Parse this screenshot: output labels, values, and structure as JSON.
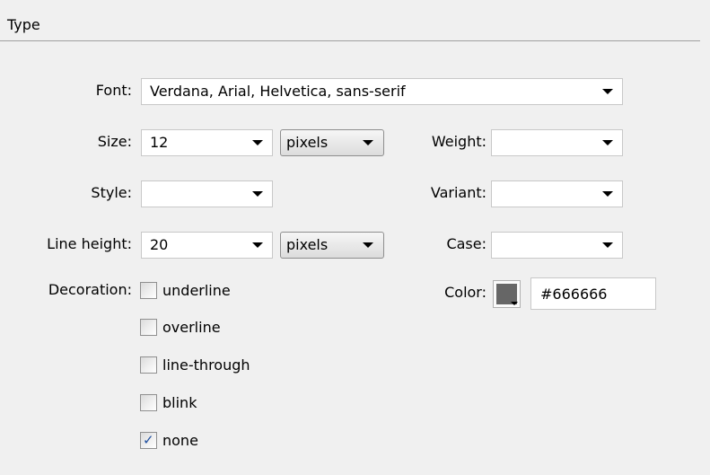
{
  "section": {
    "title": "Type"
  },
  "font": {
    "label": "Font:",
    "value": "Verdana, Arial, Helvetica, sans-serif"
  },
  "size": {
    "label": "Size:",
    "value": "12",
    "units": "pixels"
  },
  "weight": {
    "label": "Weight:",
    "value": ""
  },
  "style": {
    "label": "Style:",
    "value": ""
  },
  "variant": {
    "label": "Variant:",
    "value": ""
  },
  "line_height": {
    "label": "Line height:",
    "value": "20",
    "units": "pixels"
  },
  "case": {
    "label": "Case:",
    "value": ""
  },
  "decoration": {
    "label": "Decoration:",
    "options": [
      {
        "label": "underline",
        "checked": false
      },
      {
        "label": "overline",
        "checked": false
      },
      {
        "label": "line-through",
        "checked": false
      },
      {
        "label": "blink",
        "checked": false
      },
      {
        "label": "none",
        "checked": true
      }
    ]
  },
  "color": {
    "label": "Color:",
    "value": "#666666",
    "swatch": "#666666"
  }
}
